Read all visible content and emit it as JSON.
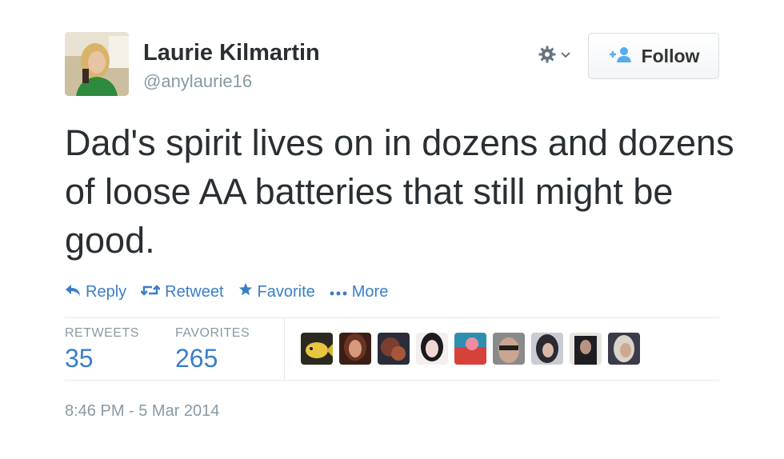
{
  "author": {
    "name": "Laurie Kilmartin",
    "handle": "@anylaurie16"
  },
  "header": {
    "follow_label": "Follow",
    "settings_icon": "gear-icon"
  },
  "tweet": {
    "text": "Dad's spirit lives on in dozens and dozens of loose AA batteries that still might be good."
  },
  "actions": {
    "reply": "Reply",
    "retweet": "Retweet",
    "favorite": "Favorite",
    "more": "More"
  },
  "stats": {
    "retweets_label": "RETWEETS",
    "retweets_value": "35",
    "favorites_label": "FAVORITES",
    "favorites_value": "265"
  },
  "timestamp": "8:46 PM - 5 Mar 2014",
  "colors": {
    "link": "#3a7ec8",
    "muted": "#8899a6",
    "text": "#292f33"
  }
}
